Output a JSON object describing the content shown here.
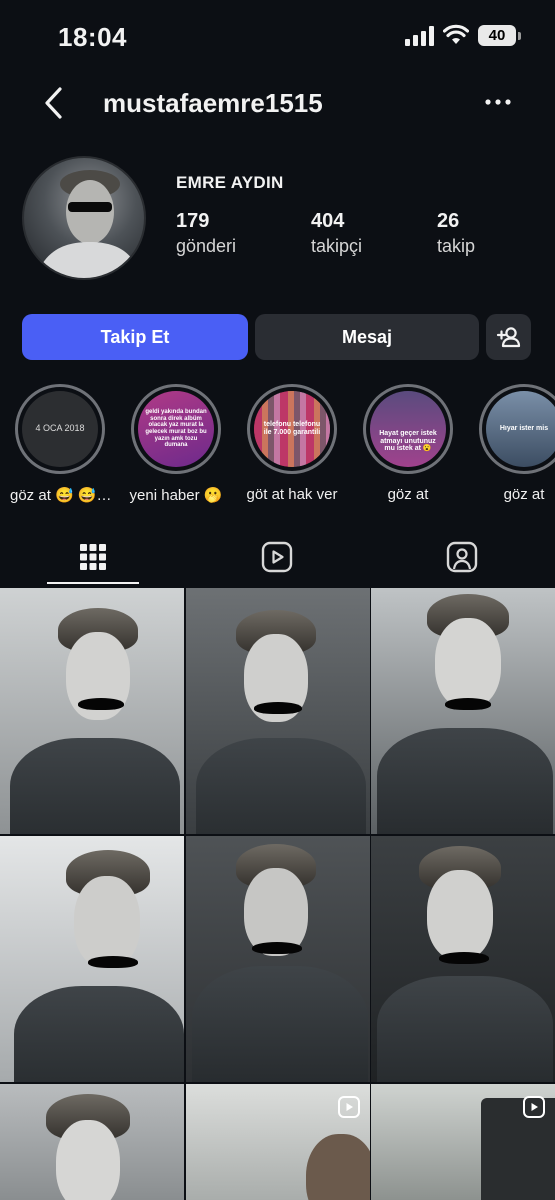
{
  "status_bar": {
    "time": "18:04",
    "battery": "40"
  },
  "header": {
    "username": "mustafaemre1515",
    "back_icon": "chevron-left-icon",
    "more_icon": "more-horizontal-icon"
  },
  "profile": {
    "name": "EMRE AYDIN",
    "stats": [
      {
        "value": "179",
        "label": "gönderi"
      },
      {
        "value": "404",
        "label": "takipçi"
      },
      {
        "value": "26",
        "label": "takip"
      }
    ]
  },
  "actions": {
    "follow_label": "Takip Et",
    "message_label": "Mesaj",
    "add_user_icon": "add-user-icon"
  },
  "highlights": [
    {
      "label": "göz at 😅 😅…",
      "cover_text": "4 OCA 2018"
    },
    {
      "label": "yeni haber 🫢",
      "cover_text": "geldi yakında bundan sonra direk albüm olacak yaz murat la gelecek murat boz bu yazın amk tozu dumana"
    },
    {
      "label": "göt at hak ver",
      "cover_text": "telefonu telefonu ile 7.000 garantili"
    },
    {
      "label": "göz at",
      "cover_text": "Hayat geçer istek atmayı unutunuz mu istek at 😮"
    },
    {
      "label": "göz at",
      "cover_text": "Hıyar ister mis"
    }
  ],
  "tabs": [
    {
      "name": "grid",
      "icon": "grid-icon",
      "active": true
    },
    {
      "name": "reels",
      "icon": "reels-icon",
      "active": false
    },
    {
      "name": "tagged",
      "icon": "tagged-person-icon",
      "active": false
    }
  ],
  "colors": {
    "accent": "#4a5ff5",
    "background": "#0c0f14",
    "button_dark": "#2a2d33"
  }
}
